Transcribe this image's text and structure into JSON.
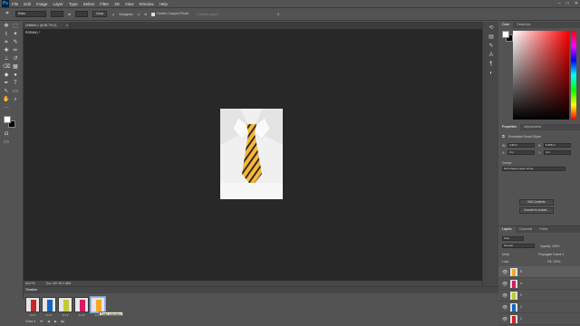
{
  "menubar": {
    "logo": "Ps",
    "items": [
      "File",
      "Edit",
      "Image",
      "Layer",
      "Type",
      "Select",
      "Filter",
      "3D",
      "View",
      "Window",
      "Help"
    ],
    "window_controls": [
      "–",
      "□",
      "✕"
    ]
  },
  "options_bar": {
    "ratio": "Ratio",
    "clear_label": "Clear",
    "straighten_label": "Straighten",
    "delete_cropped_label": "Delete Cropped Pixels",
    "content_aware_label": "Content-Aware"
  },
  "document": {
    "tab_title": "Untitled-1 @ 66.7% (1, RGB/8#) *",
    "close": "×",
    "zoom": "66.67%",
    "doc_size": "Doc: 487.4K/1.38M"
  },
  "timeline": {
    "title": "Timeline",
    "frames": [
      {
        "delay": "0.1 ▾",
        "tie": "#c62828"
      },
      {
        "delay": "0.1 ▾",
        "tie": "#1565c0"
      },
      {
        "delay": "0.1 ▾",
        "tie": "#c0ca33"
      },
      {
        "delay": "0.1 ▾",
        "tie": "#d81b60"
      },
      {
        "delay": "0.1 ▾",
        "tie": "#f9a825"
      }
    ],
    "tooltip": "Paste animation",
    "loop": "Once ▾",
    "controls": [
      "⏮",
      "◀",
      "▶",
      "▶|"
    ]
  },
  "color_panel": {
    "tabs": [
      "Color",
      "Swatches"
    ]
  },
  "properties_panel": {
    "tabs": [
      "Properties",
      "Adjustments"
    ],
    "object_type": "Embedded Smart Object",
    "w_label": "W:",
    "w_value": "4.36 in",
    "h_label": "H:",
    "h_value": "6.255 in",
    "x_label": "X:",
    "x_value": "0 in",
    "y_label": "Y:",
    "y_value": "0 in",
    "comps_label": "Comps",
    "comps_value": "Don't Apply Layer Comp",
    "edit_button": "Edit Contents",
    "convert_button": "Convert to Linked..."
  },
  "layers_panel": {
    "tabs": [
      "Layers",
      "Channels",
      "Paths"
    ],
    "kind": "Kind",
    "blend": "Normal",
    "opacity": "Opacity: 100%",
    "unify": "Unify:",
    "propagate": "Propagate Frame 1",
    "lock": "Lock:",
    "fill": "Fill: 100%",
    "layers": [
      {
        "name": "5",
        "tie": "#f9a825"
      },
      {
        "name": "4",
        "tie": "#d81b60"
      },
      {
        "name": "3",
        "tie": "#c0ca33"
      },
      {
        "name": "2",
        "tie": "#1565c0"
      },
      {
        "name": "1",
        "tie": "#c62828"
      }
    ]
  },
  "icons": {
    "move": "✥",
    "marquee": "⬚",
    "lasso": "ℓ",
    "wand": "✦",
    "crop": "⌗",
    "eyedropper": "✎",
    "heal": "✚",
    "brush": "✏",
    "stamp": "⊥",
    "history": "↺",
    "eraser": "⌫",
    "gradient": "▦",
    "blur": "◆",
    "dodge": "●",
    "pen": "✒",
    "type": "T",
    "path": "↖",
    "shape": "▭",
    "hand": "✋",
    "zoom": "⌕",
    "more": "···"
  }
}
